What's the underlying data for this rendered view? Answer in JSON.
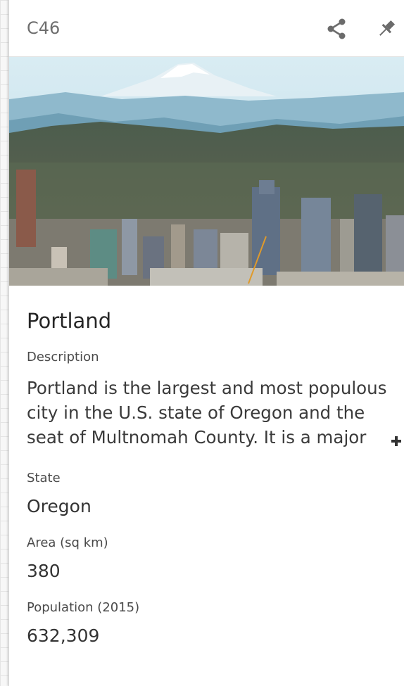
{
  "header": {
    "cell_ref": "C46",
    "share_icon": "share-icon",
    "pin_icon": "pin-icon"
  },
  "card": {
    "title": "Portland",
    "fields": {
      "description_label": "Description",
      "description_value": "Portland is the largest and most populous city in the U.S. state of Oregon and the seat of Multnomah County. It is a major",
      "state_label": "State",
      "state_value": "Oregon",
      "area_label": "Area (sq km)",
      "area_value": "380",
      "population_label": "Population (2015)",
      "population_value": "632,309"
    },
    "expand_icon": "plus-icon"
  },
  "colors": {
    "icon_gray": "#6b6b6b",
    "text_dark": "#262626",
    "label_gray": "#4a4a4a"
  }
}
